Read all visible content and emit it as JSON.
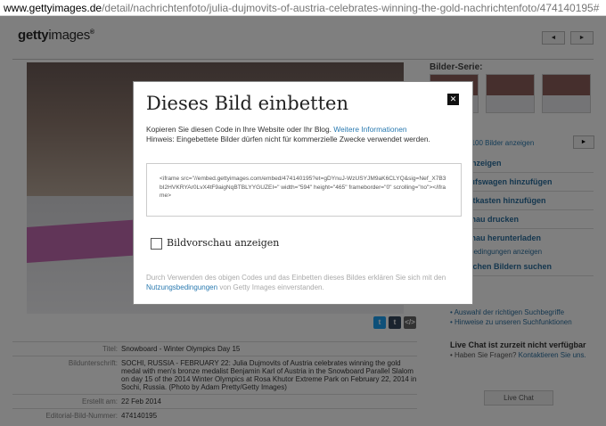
{
  "browser": {
    "url_host": "www.gettyimages.de",
    "url_path": "/detail/nachrichtenfoto/julia-dujmovits-of-austria-celebrates-winning-the-gold-nachrichtenfoto/474140195#"
  },
  "header": {
    "logo_bold": "getty",
    "logo_light": "images",
    "logo_mark": "®",
    "prev_label": "◄",
    "next_label": "►"
  },
  "series": {
    "title": "Bilder-Serie:",
    "show_all": "Alle 100 Bilder anzeigen",
    "next_label": "►"
  },
  "actions": [
    {
      "label": "...rar anzeigen",
      "sub": false
    },
    {
      "label": "...inkaufswagen hinzufügen",
      "sub": false
    },
    {
      "label": "...euchtkasten hinzufügen",
      "sub": false
    },
    {
      "label": "...orschau drucken",
      "sub": false
    },
    {
      "label": "...orschau herunterladen",
      "sub": false
    },
    {
      "label": "...gsbedingungen anzeigen",
      "sub": true
    },
    {
      "label": "...ähnlichen Bildern suchen",
      "sub": false
    }
  ],
  "meta": {
    "title_label": "Titel:",
    "title_value": "Snowboard - Winter Olympics Day 15",
    "caption_label": "Bildunterschrift:",
    "caption_value": "SOCHI, RUSSIA - FEBRUARY 22: Julia Dujmovits of Austria celebrates winning the gold medal with men's bronze medalist Benjamin Karl of Austria in the Snowboard Parallel Slalom on day 15 of the 2014 Winter Olympics at Rosa Khutor Extreme Park on February 22, 2014 in Sochi, Russia. (Photo by Adam Pretty/Getty Images)",
    "created_label": "Erstellt am:",
    "created_value": "22 Feb 2014",
    "id_label": "Editorial-Bild-Nummer:",
    "id_value": "474140195"
  },
  "help": {
    "link1": "Auswahl der richtigen Suchbegriffe",
    "link2": "Hinweise zu unseren Suchfunktionen"
  },
  "chat": {
    "title": "Live Chat ist zurzeit nicht verfügbar",
    "question": "Haben Sie Fragen?",
    "contact": "Kontaktieren Sie uns.",
    "button": "Live Chat"
  },
  "modal": {
    "title": "Dieses Bild einbetten",
    "close": "✕",
    "desc_text": "Kopieren Sie diesen Code in Ihre Website oder Ihr Blog.",
    "desc_link": "Weitere Informationen",
    "desc_hint": "Hinweis: Eingebettete Bilder dürfen nicht für kommerzielle Zwecke verwendet werden.",
    "code": "<iframe src=\"//embed.gettyimages.com/embed/474140195?et=gDYnuJ-WzUSYJM9aK6CLYQ&sig=Nef_X7B3bI2HVKRYAr0LvX4tF9aigNqBTBLYYGUZEI=\" width=\"594\" height=\"465\" frameborder=\"0\" scrolling=\"no\"></iframe>",
    "checkbox_label": "Bildvorschau anzeigen",
    "terms_text": "Durch Verwenden des obigen Codes und das Einbetten dieses Bildes erklären Sie sich mit den",
    "terms_link": "Nutzungsbedingungen",
    "terms_tail": "von Getty Images einverstanden."
  },
  "share_icons": [
    "twitter-icon",
    "tumblr-icon",
    "embed-icon"
  ],
  "colors": {
    "link": "#2a7ab0",
    "overlay": "rgba(0,0,0,0.5)"
  }
}
